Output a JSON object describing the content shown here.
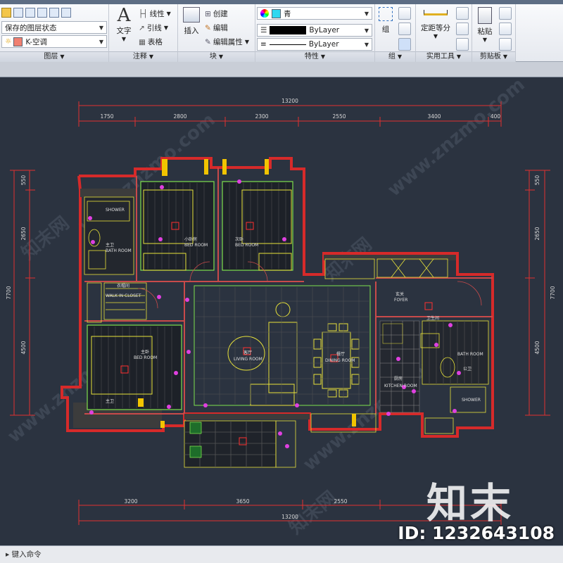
{
  "ribbon": {
    "layers": {
      "title": "图层",
      "state_combo": "保存的图层状态",
      "layer_combo": "K-空调"
    },
    "annotate": {
      "title": "注释",
      "text_label": "文字",
      "linear_label": "线性",
      "leader_label": "引线",
      "table_label": "表格"
    },
    "block": {
      "title": "块",
      "insert_label": "插入",
      "create_label": "创建",
      "edit_label": "编辑",
      "edit_attr_label": "编辑属性"
    },
    "properties": {
      "title": "特性",
      "color_combo": "青",
      "lineweight_combo": "ByLayer",
      "linetype_combo": "ByLayer"
    },
    "groups": {
      "title": "组",
      "group_label": "组"
    },
    "utilities": {
      "title": "实用工具",
      "measure_label": "定距等分"
    },
    "clipboard": {
      "title": "剪贴板",
      "paste_label": "粘贴"
    }
  },
  "drawing": {
    "dims_top": {
      "total": "13200",
      "segments": [
        "1750",
        "2800",
        "2300",
        "2550",
        "3400",
        "400"
      ]
    },
    "dims_bottom": {
      "total": "13200",
      "segments": [
        "3200",
        "3650",
        "2550"
      ]
    },
    "dims_left": {
      "total": "7700",
      "segments": [
        "550",
        "2650",
        "4500"
      ]
    },
    "dims_right": {
      "total": "7700",
      "segments": [
        "550",
        "2650",
        "4500"
      ]
    },
    "rooms": {
      "bath1_cn": "主卫",
      "bath1_en": "BATH ROOM",
      "shower1": "SHOWER",
      "bed2_cn": "小卧房",
      "bed2_en": "BED ROOM",
      "bed3_cn": "次卧",
      "bed3_en": "BED ROOM",
      "closet_cn": "衣帽间",
      "closet_en": "WALK IN CLOSET",
      "master_cn": "主卧",
      "master_en": "BED ROOM",
      "living_cn": "客厅",
      "living_en": "LIVING ROOM",
      "dining_cn": "餐厅",
      "dining_en": "DINING ROOM",
      "foyer_cn": "玄关",
      "foyer_en": "FOYER",
      "kitchen_cn": "厨房",
      "kitchen_en": "KITCHEN ROOM",
      "bath2_cn": "公卫",
      "bath2_en": "BATH ROOM",
      "shower2": "SHOWER",
      "balcony_cn": "主卫",
      "bath_lbl": "卫生间"
    }
  },
  "command": {
    "prompt": "键入命令"
  },
  "watermark": {
    "brand": "知末",
    "id": "ID: 1232643108",
    "url": "www.znzmo.com",
    "site": "知末网"
  },
  "colors": {
    "ribbon_bg": "#e9ecf1",
    "canvas_bg": "#2b3340",
    "wall_red": "#d62a2a",
    "fixture_yellow": "#e8e23a",
    "accent_magenta": "#e040e0",
    "cyan_swatch": "#2fd8f0",
    "green_line": "#7ee04e"
  }
}
